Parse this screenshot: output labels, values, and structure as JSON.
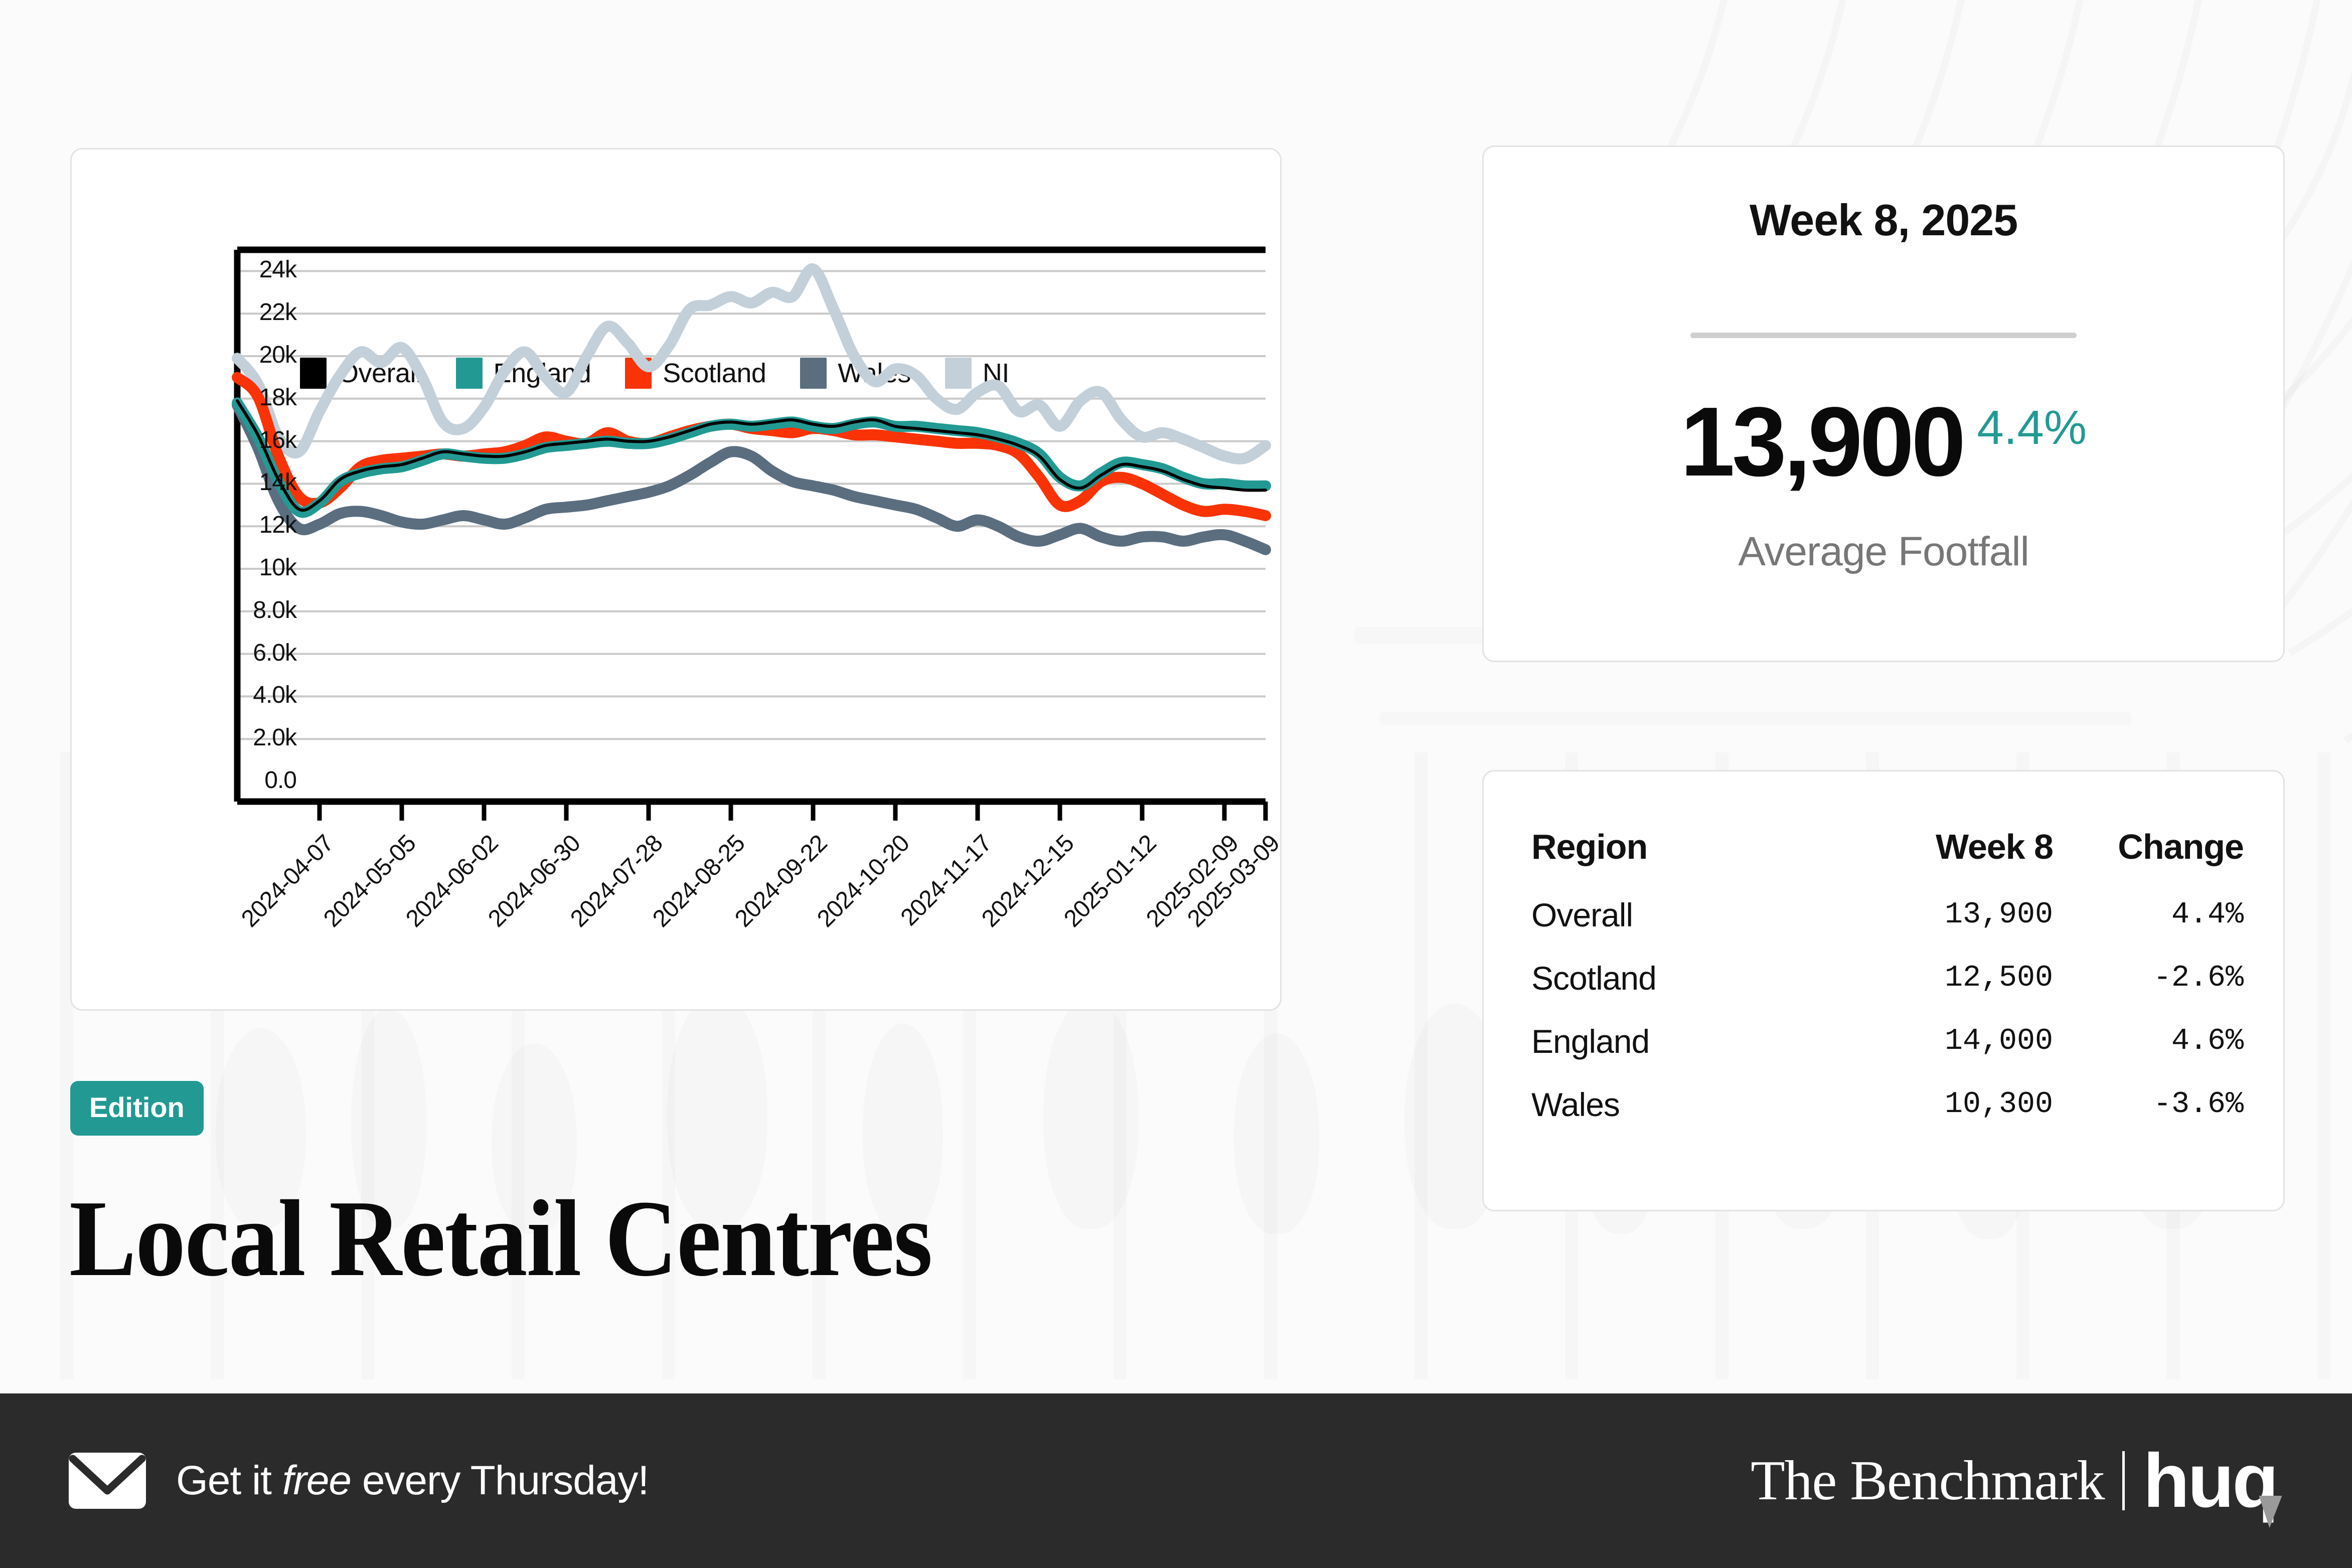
{
  "chart_data": {
    "type": "line",
    "title": "",
    "xlabel": "",
    "ylabel": "",
    "ylim": [
      0,
      25000
    ],
    "grid": true,
    "legend_position": "top-left",
    "ytick_labels": [
      "24k",
      "22k",
      "20k",
      "18k",
      "16k",
      "14k",
      "12k",
      "10k",
      "8.0k",
      "6.0k",
      "4.0k",
      "2.0k",
      "0.0"
    ],
    "ytick_values": [
      24000,
      22000,
      20000,
      18000,
      16000,
      14000,
      12000,
      10000,
      8000,
      6000,
      4000,
      2000,
      0
    ],
    "xtick_labels": [
      "2024-04-07",
      "2024-05-05",
      "2024-06-02",
      "2024-06-30",
      "2024-07-28",
      "2024-08-25",
      "2024-09-22",
      "2024-10-20",
      "2024-11-17",
      "2024-12-15",
      "2025-01-12",
      "2025-02-09",
      "2025-03-09"
    ],
    "x": [
      "2024-03-10",
      "2024-03-17",
      "2024-03-24",
      "2024-03-31",
      "2024-04-07",
      "2024-04-14",
      "2024-04-21",
      "2024-04-28",
      "2024-05-05",
      "2024-05-12",
      "2024-05-19",
      "2024-05-26",
      "2024-06-02",
      "2024-06-09",
      "2024-06-16",
      "2024-06-23",
      "2024-06-30",
      "2024-07-07",
      "2024-07-14",
      "2024-07-21",
      "2024-07-28",
      "2024-08-04",
      "2024-08-11",
      "2024-08-18",
      "2024-08-25",
      "2024-09-01",
      "2024-09-08",
      "2024-09-15",
      "2024-09-22",
      "2024-09-29",
      "2024-10-06",
      "2024-10-13",
      "2024-10-20",
      "2024-10-27",
      "2024-11-03",
      "2024-11-10",
      "2024-11-17",
      "2024-11-24",
      "2024-12-01",
      "2024-12-08",
      "2024-12-15",
      "2024-12-22",
      "2024-12-29",
      "2025-01-05",
      "2025-01-12",
      "2025-01-19",
      "2025-01-26",
      "2025-02-02",
      "2025-02-09",
      "2025-02-16",
      "2025-02-23"
    ],
    "series": [
      {
        "name": "Overall",
        "color": "#000000",
        "values": [
          17900,
          16300,
          14200,
          12800,
          13200,
          14200,
          14600,
          14800,
          14900,
          15200,
          15500,
          15400,
          15300,
          15300,
          15500,
          15800,
          15900,
          16000,
          16100,
          16000,
          16000,
          16200,
          16500,
          16800,
          16900,
          16800,
          16900,
          17000,
          16800,
          16700,
          16900,
          17000,
          16700,
          16600,
          16500,
          16400,
          16300,
          16100,
          15800,
          15300,
          14200,
          13800,
          14400,
          14900,
          14800,
          14600,
          14200,
          13900,
          13800,
          13700,
          13700
        ]
      },
      {
        "name": "England",
        "color": "#229a93",
        "values": [
          17800,
          16200,
          14100,
          12700,
          13100,
          14100,
          14500,
          14700,
          14800,
          15100,
          15400,
          15300,
          15200,
          15200,
          15400,
          15700,
          15800,
          15900,
          16000,
          15900,
          15900,
          16100,
          16400,
          16700,
          16800,
          16700,
          16800,
          16900,
          16700,
          16600,
          16800,
          16900,
          16700,
          16700,
          16600,
          16500,
          16400,
          16200,
          15900,
          15400,
          14300,
          13900,
          14500,
          15000,
          14900,
          14700,
          14300,
          14000,
          14000,
          13900,
          13900
        ]
      },
      {
        "name": "Scotland",
        "color": "#f93305",
        "values": [
          19000,
          18100,
          15300,
          13400,
          13100,
          13800,
          14800,
          15100,
          15200,
          15300,
          15400,
          15300,
          15400,
          15500,
          15800,
          16200,
          16000,
          15900,
          16400,
          16000,
          15900,
          16200,
          16500,
          16700,
          16800,
          16600,
          16500,
          16400,
          16600,
          16500,
          16300,
          16300,
          16200,
          16100,
          16000,
          15900,
          15900,
          15800,
          15400,
          14300,
          13000,
          13200,
          14100,
          14300,
          14000,
          13500,
          13000,
          12700,
          12800,
          12700,
          12500
        ]
      },
      {
        "name": "Wales",
        "color": "#5a6e80",
        "values": [
          17700,
          15700,
          13200,
          11900,
          12100,
          12600,
          12700,
          12500,
          12200,
          12100,
          12300,
          12500,
          12300,
          12100,
          12400,
          12800,
          12900,
          13000,
          13200,
          13400,
          13600,
          13900,
          14400,
          15000,
          15500,
          15300,
          14600,
          14100,
          13900,
          13700,
          13400,
          13200,
          13000,
          12800,
          12400,
          12000,
          12300,
          12000,
          11500,
          11300,
          11600,
          11900,
          11500,
          11300,
          11500,
          11500,
          11300,
          11500,
          11600,
          11300,
          10900
        ]
      },
      {
        "name": "NI",
        "color": "#c3d0da",
        "values": [
          19900,
          18700,
          16200,
          15500,
          17400,
          19100,
          20200,
          19700,
          20400,
          19000,
          16900,
          16600,
          17600,
          19300,
          20200,
          19000,
          18300,
          20000,
          21400,
          20600,
          19500,
          20500,
          22200,
          22400,
          22800,
          22500,
          23000,
          22800,
          24100,
          22200,
          20000,
          18800,
          19400,
          19100,
          18000,
          17500,
          18300,
          18600,
          17400,
          17700,
          16700,
          17900,
          18300,
          17000,
          16200,
          16400,
          16100,
          15700,
          15300,
          15200,
          15800
        ]
      }
    ]
  },
  "chart": {
    "legend": [
      {
        "label": "Overall",
        "color": "#000000"
      },
      {
        "label": "England",
        "color": "#229a93"
      },
      {
        "label": "Scotland",
        "color": "#f93305"
      },
      {
        "label": "Wales",
        "color": "#5a6e80"
      },
      {
        "label": "NI",
        "color": "#c3d0da"
      }
    ]
  },
  "kpi": {
    "title": "Week 8, 2025",
    "value": "13,900",
    "delta": "4.4%",
    "caption": "Average Footfall",
    "delta_color": "#229a93"
  },
  "table": {
    "headers": [
      "Region",
      "Week 8",
      "Change"
    ],
    "rows": [
      {
        "region": "Overall",
        "week8": "13,900",
        "change": "4.4%"
      },
      {
        "region": "Scotland",
        "week8": "12,500",
        "change": "-2.6%"
      },
      {
        "region": "England",
        "week8": "14,000",
        "change": "4.6%"
      },
      {
        "region": "Wales",
        "week8": "10,300",
        "change": "-3.6%"
      }
    ]
  },
  "header": {
    "badge": "Edition",
    "title": "Local Retail Centres",
    "badge_color": "#229a93"
  },
  "footer": {
    "cta_prefix": "Get it ",
    "cta_em": "free",
    "cta_suffix": " every Thursday!",
    "brand_primary": "The Benchmark",
    "brand_secondary": "huq",
    "background": "#2b2b2b"
  }
}
